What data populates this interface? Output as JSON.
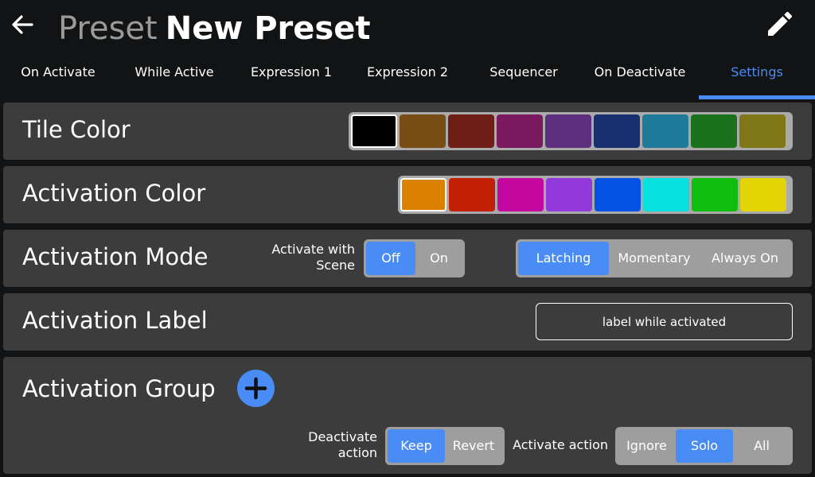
{
  "header": {
    "title_kind": "Preset",
    "title_name": "New Preset"
  },
  "tabs": [
    {
      "label": "On Activate"
    },
    {
      "label": "While Active"
    },
    {
      "label": "Expression 1"
    },
    {
      "label": "Expression 2"
    },
    {
      "label": "Sequencer"
    },
    {
      "label": "On Deactivate"
    },
    {
      "label": "Settings"
    }
  ],
  "active_tab": "Settings",
  "tile_color": {
    "label": "Tile Color",
    "selected_index": 0,
    "colors": [
      "#000000",
      "#7a4c15",
      "#6e1e17",
      "#7a1860",
      "#5e2f7e",
      "#19306e",
      "#1f7a99",
      "#1a731c",
      "#7f7718"
    ]
  },
  "activation_color": {
    "label": "Activation Color",
    "selected_index": 0,
    "colors": [
      "#dc8000",
      "#c21f05",
      "#c4079f",
      "#9139da",
      "#0452e6",
      "#07e0dc",
      "#0fbd0f",
      "#e3d405"
    ]
  },
  "activation_mode": {
    "label": "Activation Mode",
    "scene_label_1": "Activate with",
    "scene_label_2": "Scene",
    "scene_off": "Off",
    "scene_on": "On",
    "scene_value": "Off",
    "mode_latching": "Latching",
    "mode_momentary": "Momentary",
    "mode_always_on": "Always On",
    "mode_value": "Latching"
  },
  "activation_label": {
    "label": "Activation Label",
    "input_value": "label while activated"
  },
  "activation_group": {
    "label": "Activation Group",
    "deactivate_label_1": "Deactivate",
    "deactivate_label_2": "action",
    "deactivate_keep": "Keep",
    "deactivate_revert": "Revert",
    "deactivate_value": "Keep",
    "activate_label": "Activate action",
    "activate_ignore": "Ignore",
    "activate_solo": "Solo",
    "activate_all": "All",
    "activate_value": "Solo"
  },
  "colors": {
    "accent": "#4a8cf5",
    "panel": "#3c3c3c",
    "background": "#111314"
  },
  "icons": {
    "back": "arrow-left",
    "edit": "pencil",
    "add": "plus"
  }
}
